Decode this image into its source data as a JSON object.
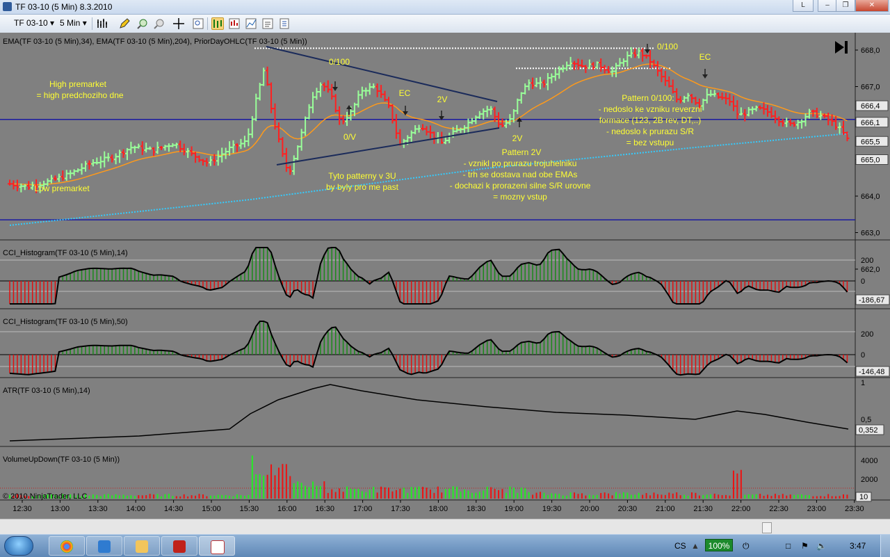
{
  "window": {
    "title": "TF 03-10 (5 Min)  8.3.2010",
    "layout_btn": "L"
  },
  "toolbar": {
    "instrument": "TF 03-10",
    "period": "5 Min"
  },
  "chart": {
    "price_panel_label": "EMA(TF 03-10 (5 Min),34), EMA(TF 03-10 (5 Min),204), PriorDayOHLC(TF 03-10 (5 Min))",
    "price_ticks": [
      "668,0",
      "667,0",
      "666,0",
      "665,0",
      "664,0",
      "663,0",
      "662,0"
    ],
    "price_tags": [
      "666,4",
      "666,1",
      "665,5",
      "665,0"
    ],
    "annotations": {
      "high_premarket_1": "High premarket",
      "high_premarket_2": "= high predchoziho dne",
      "low_premarket": "Low premarket",
      "p0100_a": "0/100",
      "p0100_b": "0/100",
      "p0v": "0/V",
      "ec_a": "EC",
      "ec_b": "EC",
      "p2v_a": "2V",
      "p2v_b": "2V",
      "tyto_1": "Tyto patterny v 3U",
      "tyto_2": "by byly pro me past",
      "pattern2v_title": "Pattern 2V",
      "pattern2v_1": "- vznikl po prurazu trojuhelniku",
      "pattern2v_2": "- trh se dostava nad obe EMAs",
      "pattern2v_3": "- dochazi k prorazeni silne S/R urovne",
      "pattern2v_4": "= mozny vstup",
      "pattern0100_title": "Pattern 0/100:",
      "pattern0100_1": "- nedoslo ke vzniku reverzni",
      "pattern0100_2": "formace (123, 2B rev, DT,..)",
      "pattern0100_3": "- nedoslo k prurazu S/R",
      "pattern0100_4": "= bez vstupu"
    },
    "cci14_label": "CCI_Histogram(TF 03-10 (5 Min),14)",
    "cci14_ticks": [
      "200",
      "0"
    ],
    "cci14_tag": "-186,67",
    "cci50_label": "CCI_Histogram(TF 03-10 (5 Min),50)",
    "cci50_ticks": [
      "200",
      "0"
    ],
    "cci50_tag": "-146,48",
    "atr_label": "ATR(TF 03-10 (5 Min),14)",
    "atr_ticks": [
      "1",
      "0,5"
    ],
    "atr_tag": "0,352",
    "vol_label": "VolumeUpDown(TF 03-10 (5 Min))",
    "vol_ticks": [
      "4000",
      "2000"
    ],
    "vol_tag": "10",
    "copyright": "© 2010 NinjaTrader, LLC",
    "time_labels": [
      "12:30",
      "13:00",
      "13:30",
      "14:00",
      "14:30",
      "15:00",
      "15:30",
      "16:00",
      "16:30",
      "17:00",
      "17:30",
      "18:00",
      "18:30",
      "19:00",
      "19:30",
      "20:00",
      "20:30",
      "21:00",
      "21:30",
      "22:00",
      "22:30",
      "23:00",
      "23:30"
    ]
  },
  "colors": {
    "up_bar": "#99ff99",
    "down_bar": "#ff2020",
    "ema34": "#ff9a1a",
    "ema204": "#33ccff",
    "annotation": "#ffff33",
    "prior_day": "#1a1aa0",
    "hist_up": "#1a8a1a",
    "hist_down": "#e01010"
  },
  "taskbar": {
    "lang": "CS",
    "zoom": "100%",
    "clock": "3:47",
    "apps": [
      "chrome-icon",
      "ie-icon",
      "explorer-icon",
      "acrobat-icon",
      "ninjatrader-icon"
    ]
  }
}
